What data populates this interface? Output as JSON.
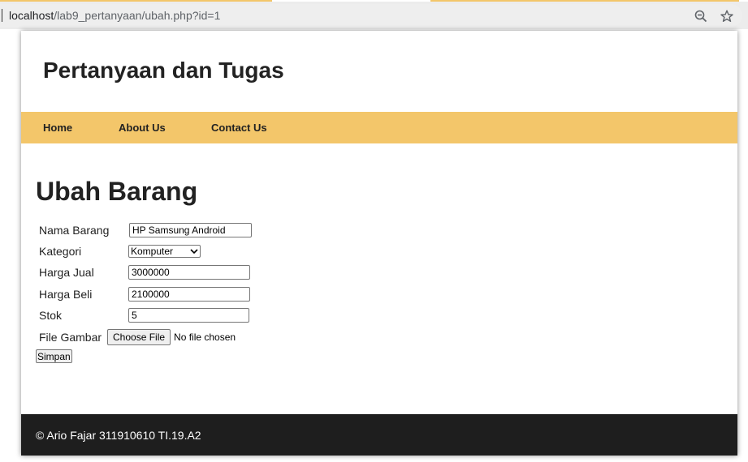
{
  "browser": {
    "url_host": "localhost",
    "url_path": "/lab9_pertanyaan/ubah.php?id=1",
    "zoom_icon": "zoom-out-icon",
    "bookmark_icon": "star-icon",
    "accent_color": "#f3c66a"
  },
  "header": {
    "title": "Pertanyaan dan Tugas"
  },
  "nav": {
    "items": [
      {
        "label": "Home"
      },
      {
        "label": "About Us"
      },
      {
        "label": "Contact Us"
      }
    ],
    "background": "#f3c66a"
  },
  "main": {
    "title": "Ubah Barang",
    "form": {
      "nama_barang": {
        "label": "Nama Barang",
        "value": "HP Samsung Android"
      },
      "kategori": {
        "label": "Kategori",
        "value": "Komputer"
      },
      "harga_jual": {
        "label": "Harga Jual",
        "value": "3000000"
      },
      "harga_beli": {
        "label": "Harga Beli",
        "value": "2100000"
      },
      "stok": {
        "label": "Stok",
        "value": "5"
      },
      "file_gambar": {
        "label": "File Gambar",
        "button_label": "Choose File",
        "status": "No file chosen"
      },
      "submit_label": "Simpan"
    }
  },
  "footer": {
    "text": "© Ario Fajar 311910610 TI.19.A2",
    "background": "#1e1e1e"
  }
}
